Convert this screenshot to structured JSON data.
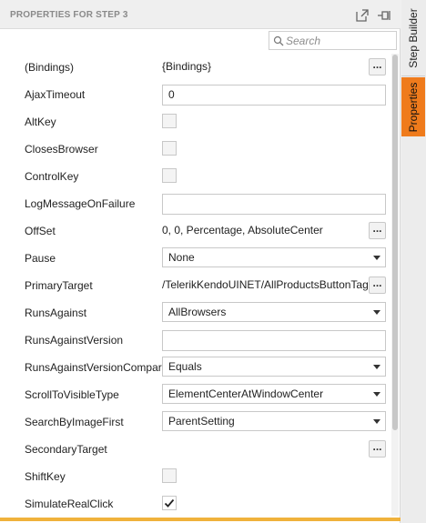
{
  "panel": {
    "title": "PROPERTIES FOR STEP 3",
    "icons": [
      "popout-icon",
      "pin-icon"
    ]
  },
  "search": {
    "placeholder": "Search",
    "value": ""
  },
  "properties": [
    {
      "name": "(Bindings)",
      "type": "text-dots",
      "value": "{Bindings}"
    },
    {
      "name": "AjaxTimeout",
      "type": "textbox",
      "value": "0"
    },
    {
      "name": "AltKey",
      "type": "checkbox",
      "checked": false
    },
    {
      "name": "ClosesBrowser",
      "type": "checkbox",
      "checked": false
    },
    {
      "name": "ControlKey",
      "type": "checkbox",
      "checked": false
    },
    {
      "name": "LogMessageOnFailure",
      "type": "textbox",
      "value": ""
    },
    {
      "name": "OffSet",
      "type": "text-dots",
      "value": "0, 0, Percentage, AbsoluteCenter"
    },
    {
      "name": "Pause",
      "type": "dropdown",
      "value": "None"
    },
    {
      "name": "PrimaryTarget",
      "type": "text-dots",
      "value": "/TelerikKendoUINET/AllProductsButtonTag"
    },
    {
      "name": "RunsAgainst",
      "type": "dropdown",
      "value": "AllBrowsers"
    },
    {
      "name": "RunsAgainstVersion",
      "type": "textbox",
      "value": ""
    },
    {
      "name": "RunsAgainstVersionCompare",
      "type": "dropdown",
      "value": "Equals"
    },
    {
      "name": "ScrollToVisibleType",
      "type": "dropdown",
      "value": "ElementCenterAtWindowCenter"
    },
    {
      "name": "SearchByImageFirst",
      "type": "dropdown",
      "value": "ParentSetting"
    },
    {
      "name": "SecondaryTarget",
      "type": "text-dots",
      "value": ""
    },
    {
      "name": "ShiftKey",
      "type": "checkbox",
      "checked": false
    },
    {
      "name": "SimulateRealClick",
      "type": "checkbox",
      "checked": true
    }
  ],
  "dots_label": "...",
  "side_tabs": [
    {
      "label": "Step Builder",
      "active": false
    },
    {
      "label": "Properties",
      "active": true
    }
  ],
  "colors": {
    "accent": "#ef7b1c",
    "bottom_bar": "#f0b23c"
  }
}
